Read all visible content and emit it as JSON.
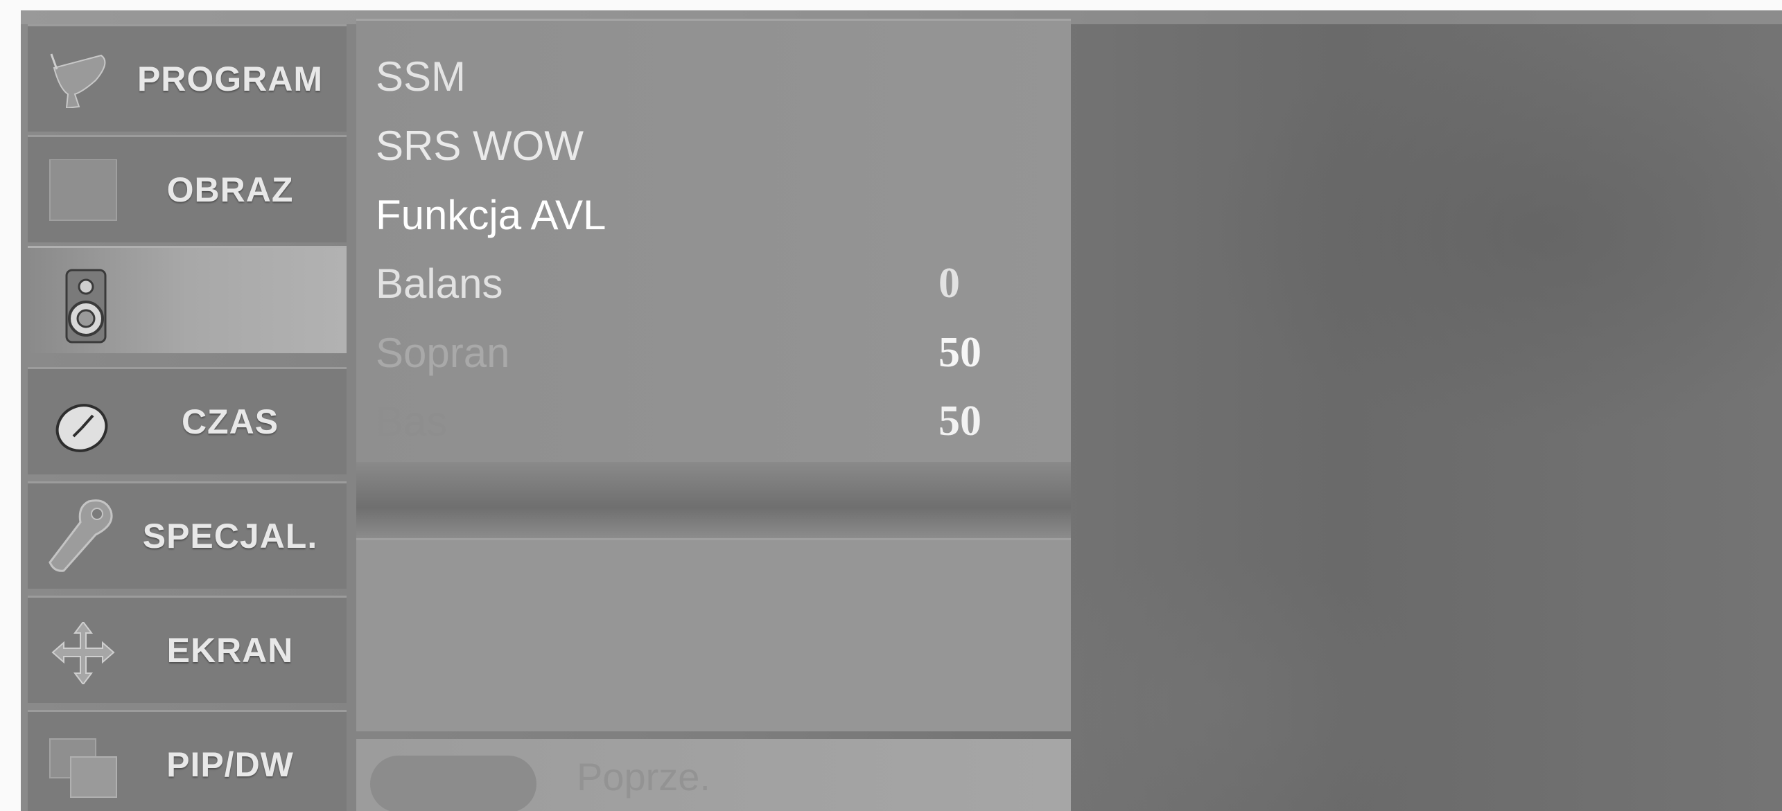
{
  "sidebar": {
    "items": [
      {
        "label": "PROGRAM",
        "icon": "satellite-dish-icon"
      },
      {
        "label": "OBRAZ",
        "icon": "picture-square-icon"
      },
      {
        "label": "",
        "icon": "speaker-icon",
        "active": true
      },
      {
        "label": "CZAS",
        "icon": "clock-icon"
      },
      {
        "label": "SPECJAL.",
        "icon": "tag-icon"
      },
      {
        "label": "EKRAN",
        "icon": "move-arrows-icon"
      },
      {
        "label": "PIP/DW",
        "icon": "pip-windows-icon"
      }
    ]
  },
  "menu": {
    "rows": [
      {
        "label": "SSM",
        "value": ""
      },
      {
        "label": "SRS WOW",
        "value": ""
      },
      {
        "label": "Funkcja AVL",
        "value": ""
      },
      {
        "label": "Balans",
        "value": "0"
      },
      {
        "label": "Sopran",
        "value": "50"
      },
      {
        "label": "Bas",
        "value": "50"
      }
    ]
  },
  "footer": {
    "back_label": "Poprze."
  }
}
